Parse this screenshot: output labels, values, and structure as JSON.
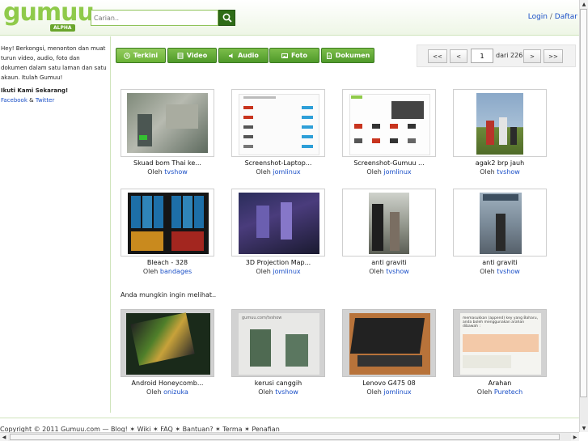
{
  "brand": {
    "name": "gumuu",
    "tag": "ALPHA",
    "color": "#8fca4a"
  },
  "search": {
    "placeholder": "Carian..",
    "button_icon": "search-icon"
  },
  "auth": {
    "login": "Login",
    "separator": "/",
    "register": "Daftar"
  },
  "sidebar": {
    "intro": "Hey! Berkongsi, menonton dan muat turun video, audio, foto dan dokumen dalam satu laman dan satu akaun. Itulah Gumuu!",
    "follow_heading": "Ikuti Kami Sekarang!",
    "facebook": "Facebook",
    "and": "&",
    "twitter": "Twitter"
  },
  "tabs": [
    {
      "label": "Terkini",
      "icon": "clock-icon"
    },
    {
      "label": "Video",
      "icon": "film-icon"
    },
    {
      "label": "Audio",
      "icon": "speaker-icon"
    },
    {
      "label": "Foto",
      "icon": "photo-icon"
    },
    {
      "label": "Dokumen",
      "icon": "document-icon"
    }
  ],
  "pager": {
    "first": "<<",
    "prev": "<",
    "current": "1",
    "total_text": "dari 226",
    "next": ">",
    "last": ">>"
  },
  "items": [
    {
      "title": "Skuad bom Thai ke...",
      "by": "Oleh",
      "user": "tvshow"
    },
    {
      "title": "Screenshot-Laptop...",
      "by": "Oleh",
      "user": "jomlinux"
    },
    {
      "title": "Screenshot-Gumuu ...",
      "by": "Oleh",
      "user": "jomlinux"
    },
    {
      "title": "agak2 brp jauh",
      "by": "Oleh",
      "user": "tvshow"
    },
    {
      "title": "Bleach - 328",
      "by": "Oleh",
      "user": "bandages"
    },
    {
      "title": "3D Projection Map...",
      "by": "Oleh",
      "user": "jomlinux"
    },
    {
      "title": "anti graviti",
      "by": "Oleh",
      "user": "tvshow"
    },
    {
      "title": "anti graviti",
      "by": "Oleh",
      "user": "tvshow"
    }
  ],
  "suggest_heading": "Anda mungkin ingin melihat..",
  "suggested": [
    {
      "title": "Android Honeycomb...",
      "by": "Oleh",
      "user": "onizuka"
    },
    {
      "title": "kerusi canggih",
      "by": "Oleh",
      "user": "tvshow",
      "caption": "gumuu.com/tvshow"
    },
    {
      "title": "Lenovo G475 08",
      "by": "Oleh",
      "user": "jomlinux"
    },
    {
      "title": "Arahan",
      "by": "Oleh",
      "user": "Puretech",
      "snippet": "memasukkan (append) key yang Baharu, anda boleh menggunakan arahan dibawah :"
    }
  ],
  "footer": "Copyright © 2011 Gumuu.com — Blog! ✶ Wiki ✶ FAQ ✶ Bantuan? ✶ Terma ✶ Penafian"
}
